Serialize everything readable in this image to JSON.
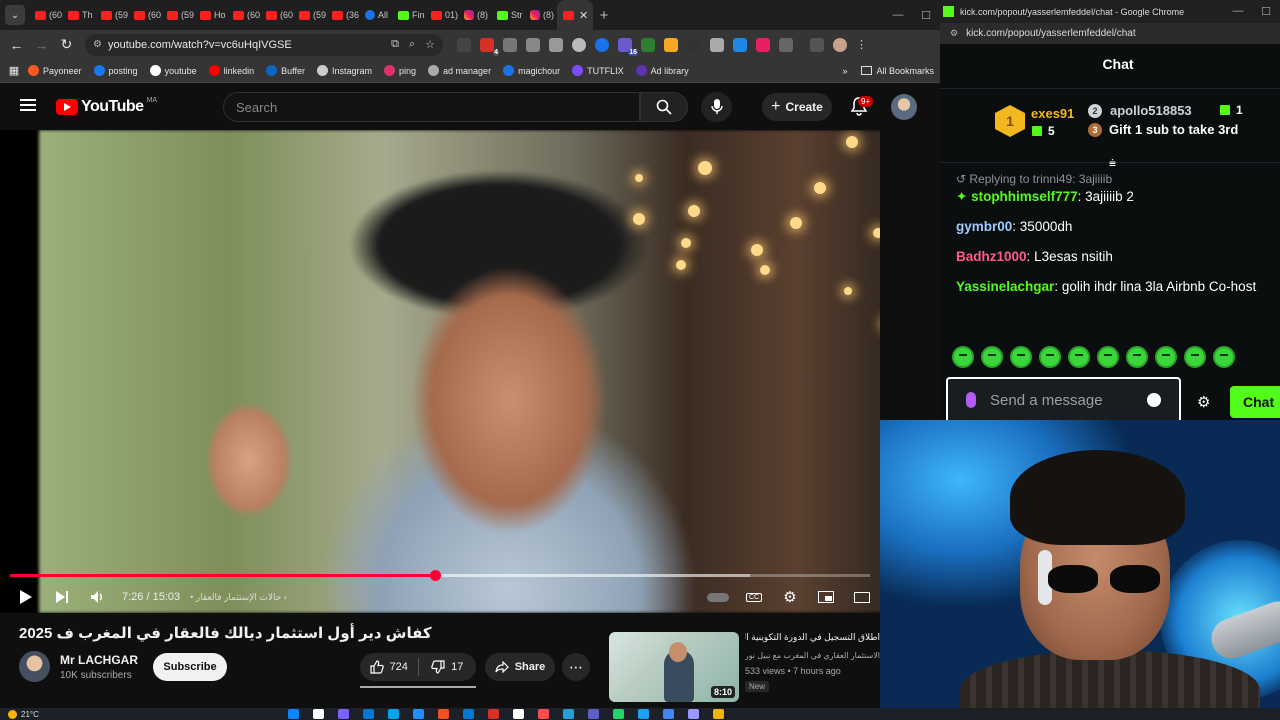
{
  "browser": {
    "tab_labels": [
      "(60",
      "Th",
      "(59",
      "(60",
      "(59",
      "Ho",
      "(60",
      "(60",
      "(59",
      "(36",
      "All",
      "Fin",
      "01)",
      "(8)",
      "Str",
      "(8)"
    ],
    "active_tab_close": "✕",
    "new_tab": "+",
    "url": "youtube.com/watch?v=vc6uHqIVGSE",
    "ext_badge_1": "4",
    "ext_badge_2": "16",
    "bookmarks": [
      "Payoneer",
      "posting",
      "youtube",
      "linkedin",
      "Buffer",
      "Instagram",
      "ping",
      "ad manager",
      "magichour",
      "TUTFLIX",
      "Ad library"
    ],
    "all_bookmarks": "All Bookmarks"
  },
  "youtube": {
    "logo_text": "YouTube",
    "country": "MA",
    "search_placeholder": "Search",
    "create_label": "Create",
    "notif_count": "9+",
    "player": {
      "current_time": "7:26",
      "duration": "15:03",
      "time_display": "7:26 / 15:03",
      "chapter": "حالات الإستثمار فالعقار",
      "progress_fraction": 0.494,
      "buffer_fraction": 0.86
    },
    "video_title": "كفاش دير أول استثمار ديالك فالعقار في المغرب ف 2025",
    "channel_name": "Mr LACHGAR",
    "channel_subs": "10K subscribers",
    "subscribe_label": "Subscribe",
    "likes": "724",
    "dislikes": "17",
    "share_label": "Share",
    "more": "⋯",
    "related": {
      "title": "اطلاق التسجيل في الدورة التكوينية الثامنة",
      "subtitle": "الاستثمار العقاري في المغرب مع نبيل نور",
      "meta": "533 views • 7 hours ago",
      "badge": "New",
      "duration": "8:10"
    }
  },
  "kick": {
    "window_title": "kick.com/popout/yasserlemfeddel/chat - Google Chrome",
    "url": "kick.com/popout/yasserlemfeddel/chat",
    "chat_title": "Chat",
    "top_gifters": {
      "first": {
        "rank": "1",
        "name": "exes91",
        "count": "5"
      },
      "second": {
        "rank": "2",
        "name": "apollo518853",
        "count": "1"
      },
      "third": {
        "rank": "3",
        "text": "Gift 1 sub to take 3rd"
      }
    },
    "reply_to": "Replying to trinni49: 3ajiiiib",
    "messages": [
      {
        "user": "stophhimself777",
        "text": "3ajiiiib 2",
        "color": "#53fc18"
      },
      {
        "user": "gymbr00",
        "text": "35000dh",
        "color": "#9ecbff"
      },
      {
        "user": "Badhz1000",
        "text": "L3esas nsitih",
        "color": "#ff5c8a"
      },
      {
        "user": "Yassinelachgar",
        "text": "golih ihdr lina 3la Airbnb Co-host",
        "color": "#53fc18"
      }
    ],
    "input_placeholder": "Send a message",
    "send_label": "Chat"
  },
  "taskbar": {
    "temperature": "21°C"
  },
  "colors": {
    "yt_red": "#ff0033",
    "kick_green": "#53fc18",
    "gold": "#f3b81f"
  }
}
